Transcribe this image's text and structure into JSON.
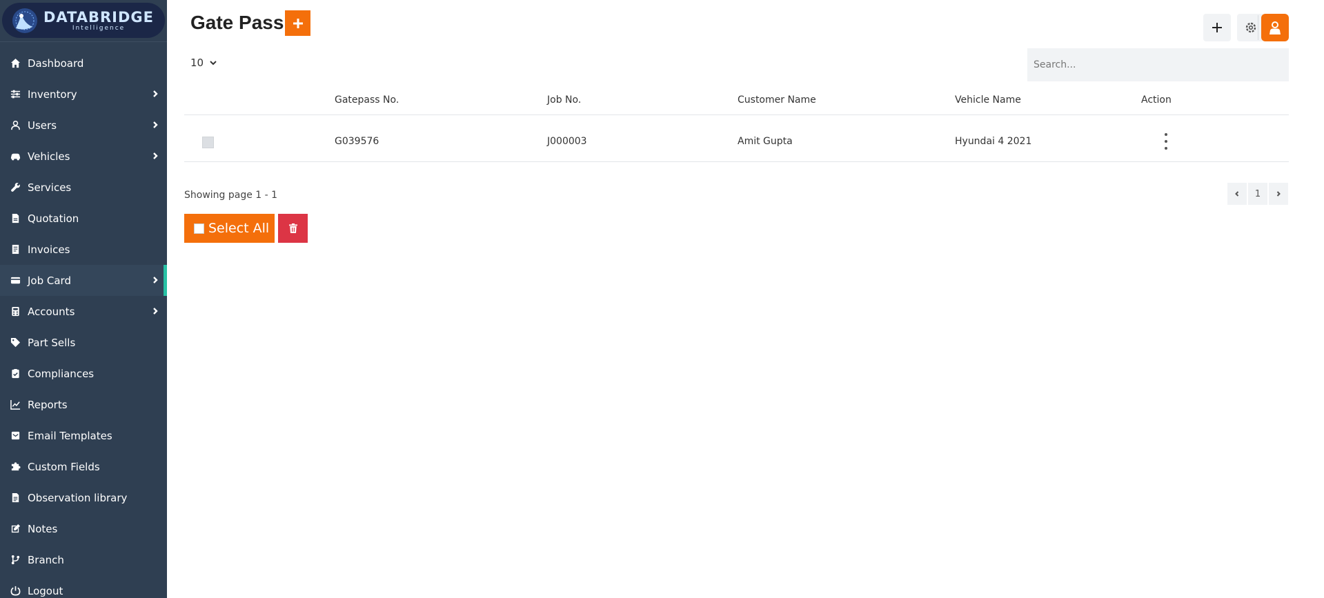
{
  "brand": {
    "title": "DATABRIDGE",
    "subtitle": "Intelligence"
  },
  "sidebar": {
    "items": [
      {
        "label": "Dashboard",
        "icon": "home-icon",
        "has_children": false
      },
      {
        "label": "Inventory",
        "icon": "sliders-icon",
        "has_children": true
      },
      {
        "label": "Users",
        "icon": "user-icon",
        "has_children": true
      },
      {
        "label": "Vehicles",
        "icon": "car-icon",
        "has_children": true
      },
      {
        "label": "Services",
        "icon": "wrench-icon",
        "has_children": false
      },
      {
        "label": "Quotation",
        "icon": "file-invoice-icon",
        "has_children": false
      },
      {
        "label": "Invoices",
        "icon": "receipt-icon",
        "has_children": false
      },
      {
        "label": "Job Card",
        "icon": "card-icon",
        "has_children": true,
        "active": true
      },
      {
        "label": "Accounts",
        "icon": "calculator-icon",
        "has_children": true
      },
      {
        "label": "Part Sells",
        "icon": "tag-icon",
        "has_children": false
      },
      {
        "label": "Compliances",
        "icon": "clipboard-check-icon",
        "has_children": false
      },
      {
        "label": "Reports",
        "icon": "chart-line-icon",
        "has_children": false
      },
      {
        "label": "Email Templates",
        "icon": "mail-bulk-icon",
        "has_children": false
      },
      {
        "label": "Custom Fields",
        "icon": "puzzle-icon",
        "has_children": false
      },
      {
        "label": "Observation library",
        "icon": "file-alt-icon",
        "has_children": false
      },
      {
        "label": "Notes",
        "icon": "edit-icon",
        "has_children": false
      },
      {
        "label": "Branch",
        "icon": "code-branch-icon",
        "has_children": false
      },
      {
        "label": "Logout",
        "icon": "power-icon",
        "has_children": false
      }
    ]
  },
  "header": {
    "title": "Gate Pass"
  },
  "controls": {
    "page_size": "10",
    "search_placeholder": "Search..."
  },
  "table": {
    "columns": [
      "Gatepass No.",
      "Job No.",
      "Customer Name",
      "Vehicle Name",
      "Action"
    ],
    "rows": [
      {
        "gatepass_no": "G039576",
        "job_no": "J000003",
        "customer_name": "Amit Gupta",
        "vehicle_name": "Hyundai 4 2021"
      }
    ]
  },
  "footer": {
    "showing": "Showing page 1 - 1",
    "current_page": "1",
    "select_all_label": "Select All"
  },
  "colors": {
    "sidebar_bg": "#2f3f52",
    "accent": "#f46f0b",
    "danger": "#dc3545",
    "active_marker": "#27c1a4"
  }
}
